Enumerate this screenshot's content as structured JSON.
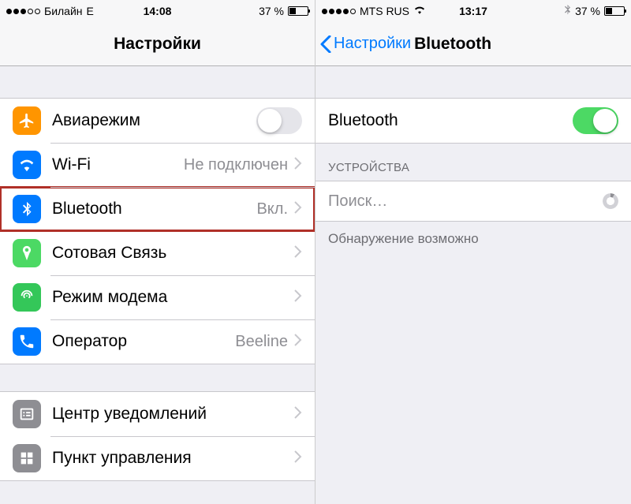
{
  "left": {
    "status": {
      "carrier": "Билайн",
      "network": "E",
      "time": "14:08",
      "battery_pct": "37 %",
      "signal_filled": 3
    },
    "nav": {
      "title": "Настройки"
    },
    "rows": {
      "airplane": {
        "label": "Авиарежим"
      },
      "wifi": {
        "label": "Wi-Fi",
        "value": "Не подключен"
      },
      "bluetooth": {
        "label": "Bluetooth",
        "value": "Вкл."
      },
      "cellular": {
        "label": "Сотовая Связь"
      },
      "hotspot": {
        "label": "Режим модема"
      },
      "carrier": {
        "label": "Оператор",
        "value": "Beeline"
      },
      "notif": {
        "label": "Центр уведомлений"
      },
      "control": {
        "label": "Пункт управления"
      }
    }
  },
  "right": {
    "status": {
      "carrier": "MTS RUS",
      "time": "13:17",
      "battery_pct": "37 %",
      "signal_filled": 4
    },
    "nav": {
      "back": "Настройки",
      "title": "Bluetooth"
    },
    "toggle": {
      "label": "Bluetooth",
      "on": true
    },
    "devices_header": "УСТРОЙСТВА",
    "searching": "Поиск…",
    "discoverable": "Обнаружение возможно"
  }
}
